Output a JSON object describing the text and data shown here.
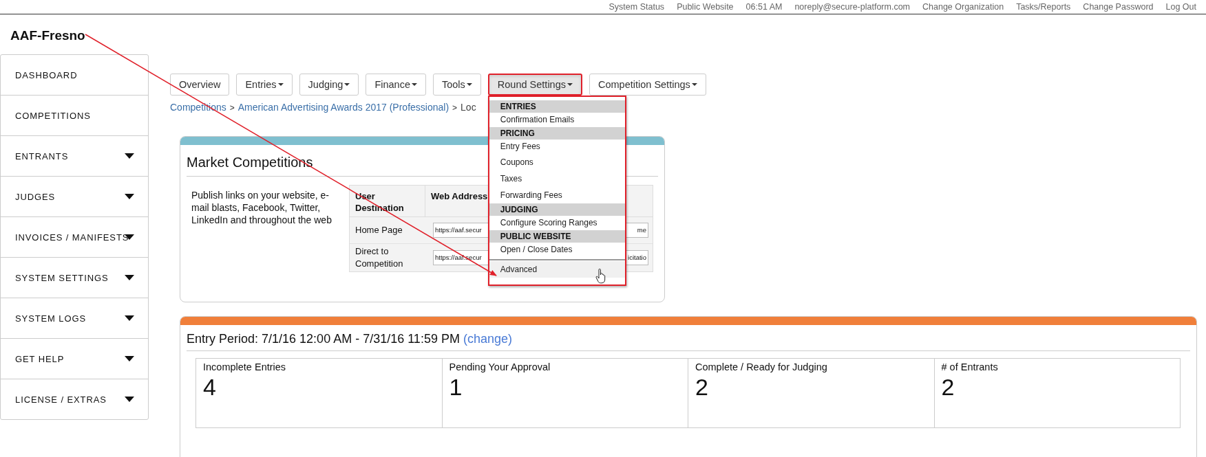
{
  "top_links": [
    "System Status",
    "Public Website",
    "06:51 AM",
    "noreply@secure-platform.com",
    "Change Organization",
    "Tasks/Reports",
    "Change Password",
    "Log Out"
  ],
  "organization": "AAF-Fresno",
  "sidebar": {
    "items": [
      {
        "label": "DASHBOARD",
        "expandable": false
      },
      {
        "label": "COMPETITIONS",
        "expandable": false
      },
      {
        "label": "ENTRANTS",
        "expandable": true
      },
      {
        "label": "JUDGES",
        "expandable": true
      },
      {
        "label": "INVOICES / MANIFESTS",
        "expandable": true
      },
      {
        "label": "SYSTEM SETTINGS",
        "expandable": true
      },
      {
        "label": "SYSTEM LOGS",
        "expandable": true
      },
      {
        "label": "GET HELP",
        "expandable": true
      },
      {
        "label": "LICENSE / EXTRAS",
        "expandable": true
      }
    ]
  },
  "nav_tabs": [
    {
      "label": "Overview",
      "has_menu": false,
      "selected": false
    },
    {
      "label": "Entries",
      "has_menu": true,
      "selected": false
    },
    {
      "label": "Judging",
      "has_menu": true,
      "selected": false
    },
    {
      "label": "Finance",
      "has_menu": true,
      "selected": false
    },
    {
      "label": "Tools",
      "has_menu": true,
      "selected": false
    },
    {
      "label": "Round Settings",
      "has_menu": true,
      "selected": true
    },
    {
      "label": "Competition Settings",
      "has_menu": true,
      "selected": false
    }
  ],
  "breadcrumb": [
    {
      "label": "Competitions",
      "kind": "link"
    },
    {
      "label": ">",
      "kind": "separator"
    },
    {
      "label": "American Advertising Awards 2017 (Professional)",
      "kind": "link"
    },
    {
      "label": ">",
      "kind": "separator"
    },
    {
      "label": "Loc",
      "kind": "text"
    }
  ],
  "round_settings_menu": [
    {
      "kind": "header",
      "label": "ENTRIES"
    },
    {
      "kind": "item",
      "label": "Confirmation Emails",
      "selected": false
    },
    {
      "kind": "header",
      "label": "PRICING"
    },
    {
      "kind": "item",
      "label": "Entry Fees",
      "selected": false
    },
    {
      "kind": "item",
      "label": "Coupons",
      "selected": false
    },
    {
      "kind": "item",
      "label": "Taxes",
      "selected": false
    },
    {
      "kind": "item",
      "label": "Forwarding Fees",
      "selected": false
    },
    {
      "kind": "header",
      "label": "JUDGING"
    },
    {
      "kind": "item",
      "label": "Configure Scoring Ranges",
      "selected": false
    },
    {
      "kind": "header",
      "label": "PUBLIC WEBSITE"
    },
    {
      "kind": "item",
      "label": "Open / Close Dates",
      "selected": false
    },
    {
      "kind": "divider"
    },
    {
      "kind": "item",
      "label": "Advanced",
      "selected": true
    }
  ],
  "market_competitions": {
    "title": "Market Competitions",
    "description": "Publish links on your website, e-mail blasts, Facebook, Twitter, LinkedIn and throughout the web",
    "table": {
      "columns": [
        "User Destination",
        "Web Address"
      ],
      "rows": [
        {
          "destination": "Home Page",
          "url_start": "https://aaf.secur",
          "url_end": "me"
        },
        {
          "destination": "Direct to Competition",
          "url_start": "https://aaf.secur",
          "url_end": "icitatio"
        }
      ]
    }
  },
  "entry_period": {
    "title": "Entry Period: 7/1/16 12:00 AM - 7/31/16 11:59 PM",
    "link": "(change)",
    "stats": [
      {
        "label": "Incomplete Entries",
        "value": "4"
      },
      {
        "label": "Pending Your Approval",
        "value": "1"
      },
      {
        "label": "Complete / Ready for Judging",
        "value": "2"
      },
      {
        "label": "# of Entrants",
        "value": "2"
      }
    ]
  }
}
